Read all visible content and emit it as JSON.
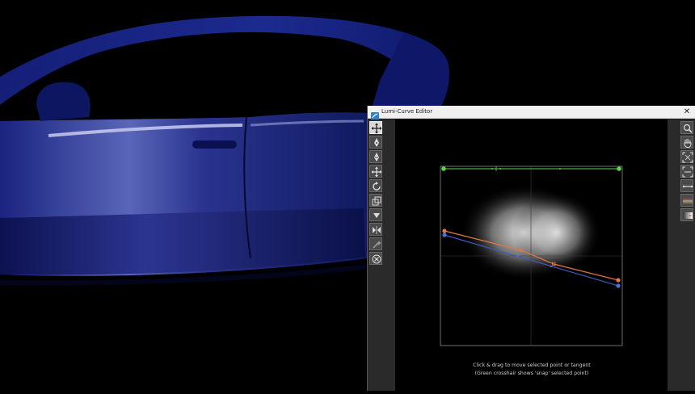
{
  "window": {
    "title": "Lumi-Curve Editor",
    "close_glyph": "✕"
  },
  "hint": {
    "line1": "Click & drag to move selected point or tangent",
    "line2": "(Green crosshair shows 'snap' selected point)"
  },
  "left_tools": [
    {
      "icon": "move-arrows-icon",
      "active": true
    },
    {
      "icon": "pen-add-point-icon"
    },
    {
      "icon": "pen-remove-point-icon"
    },
    {
      "icon": "move-points-icon"
    },
    {
      "icon": "rotate-icon"
    },
    {
      "icon": "scale-icon"
    },
    {
      "icon": "triangle-down-icon"
    },
    {
      "icon": "flip-horizontal-icon"
    },
    {
      "icon": "magic-wand-icon"
    },
    {
      "icon": "reset-icon"
    }
  ],
  "right_tools": [
    {
      "icon": "zoom-icon"
    },
    {
      "icon": "pan-hand-icon"
    },
    {
      "icon": "fit-view-icon"
    },
    {
      "icon": "fit-selection-icon"
    },
    {
      "icon": "line-style-icon"
    },
    {
      "icon": "color-curves-icon"
    },
    {
      "icon": "gradient-swatch-icon"
    }
  ],
  "colors": {
    "selected_curve": "#e07a45",
    "base_curve": "#3b5bb8",
    "snap_crosshair": "#5fd34a",
    "car_paint": "#121c6b",
    "panel_bg": "#1b1b1b"
  }
}
